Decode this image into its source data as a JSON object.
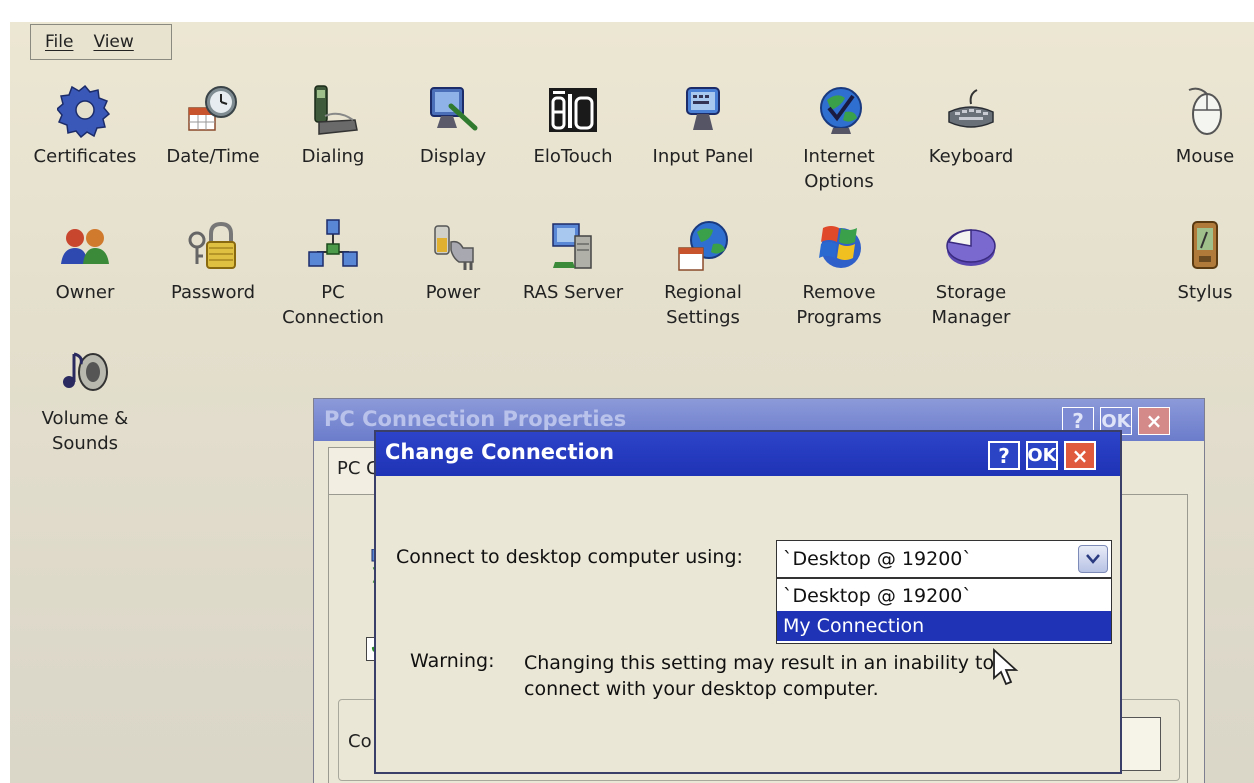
{
  "menubar": {
    "file": "File",
    "view": "View"
  },
  "icons_row1": [
    {
      "label": "Certificates",
      "icon": "gear-icon"
    },
    {
      "label": "Date/Time",
      "icon": "clock-calendar-icon"
    },
    {
      "label": "Dialing",
      "icon": "phone-icon"
    },
    {
      "label": "Display",
      "icon": "monitor-brush-icon"
    },
    {
      "label": "EloTouch",
      "icon": "elo-logo-icon"
    },
    {
      "label": "Input Panel",
      "icon": "keyboard-monitor-icon"
    },
    {
      "label": "Internet\nOptions",
      "icon": "globe-check-icon"
    },
    {
      "label": "Keyboard",
      "icon": "keyboard-icon"
    },
    {
      "label": "Mouse",
      "icon": "mouse-icon"
    }
  ],
  "icons_row2": [
    {
      "label": "Owner",
      "icon": "users-icon"
    },
    {
      "label": "Password",
      "icon": "padlock-keys-icon"
    },
    {
      "label": "PC\nConnection",
      "icon": "network-computers-icon"
    },
    {
      "label": "Power",
      "icon": "battery-plug-icon"
    },
    {
      "label": "RAS Server",
      "icon": "server-network-icon"
    },
    {
      "label": "Regional\nSettings",
      "icon": "globe-calendar-icon"
    },
    {
      "label": "Remove\nPrograms",
      "icon": "windows-flag-icon"
    },
    {
      "label": "Storage\nManager",
      "icon": "pie-disk-icon"
    },
    {
      "label": "Stylus",
      "icon": "pda-stylus-icon"
    }
  ],
  "icons_row3": [
    {
      "label": "Volume &\nSounds",
      "icon": "speaker-note-icon"
    }
  ],
  "bg_dialog": {
    "title": "PC Connection Properties",
    "help": "?",
    "ok": "OK",
    "close": "×",
    "tab": "PC C",
    "group_text": "Co"
  },
  "dialog": {
    "title": "Change Connection",
    "help": "?",
    "ok": "OK",
    "close": "×",
    "connect_label": "Connect to desktop computer using:",
    "selected": "`Desktop @ 19200`",
    "options": [
      "`Desktop @ 19200`",
      "My Connection"
    ],
    "warning_label": "Warning:",
    "warning_text": "Changing this setting may result in an inability to connect with your desktop computer."
  },
  "colors": {
    "titlebar_active": "#1e33b5",
    "titlebar_inactive": "#6b7ccb",
    "close_button": "#e05a3e",
    "selection": "#1e33b5",
    "desktop": "#e4dfcd"
  }
}
